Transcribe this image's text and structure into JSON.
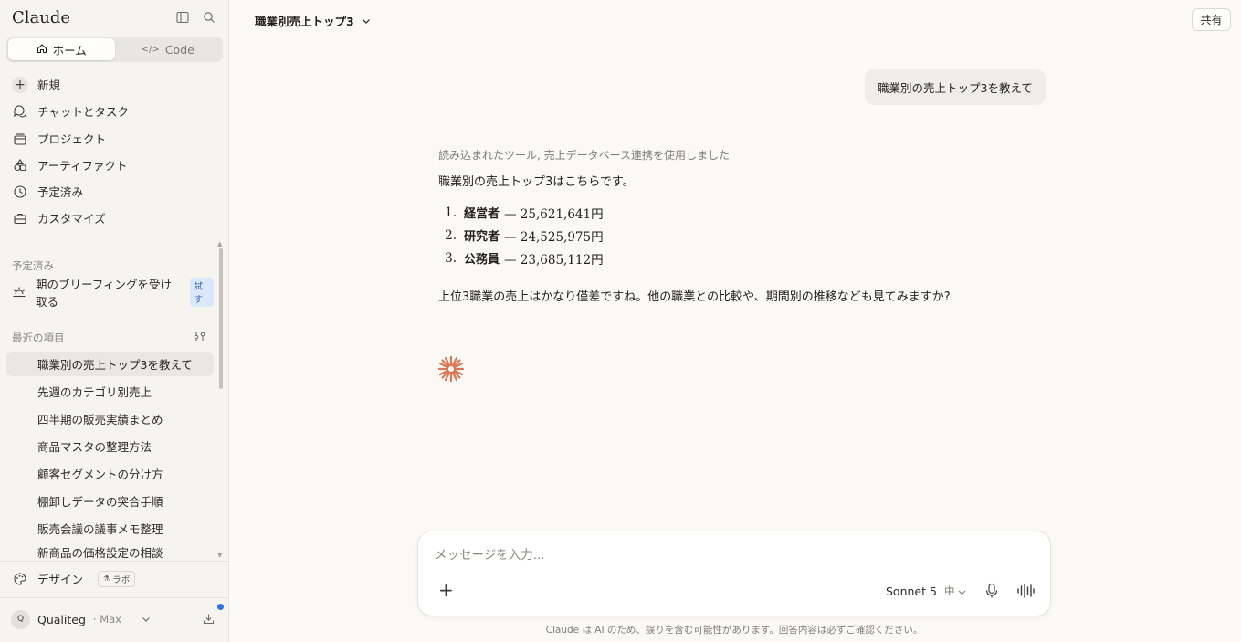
{
  "sidebar": {
    "brand": "Claude",
    "tabs": [
      {
        "label": "ホーム",
        "icon": "home-icon"
      },
      {
        "label": "Code",
        "icon": "code-icon"
      }
    ],
    "nav": [
      {
        "label": "新規",
        "icon": "plus-icon"
      },
      {
        "label": "チャットとタスク",
        "icon": "chat-icon"
      },
      {
        "label": "プロジェクト",
        "icon": "folder-icon"
      },
      {
        "label": "アーティファクト",
        "icon": "artifact-icon"
      },
      {
        "label": "予定済み",
        "icon": "clock-icon"
      },
      {
        "label": "カスタマイズ",
        "icon": "briefcase-icon"
      }
    ],
    "scheduled_label": "予定済み",
    "scheduled_item": {
      "label": "朝のブリーフィングを受け取る",
      "badge": "試す"
    },
    "recent_label": "最近の項目",
    "recents": [
      "職業別の売上トップ3を教えて",
      "先週のカテゴリ別売上",
      "四半期の販売実績まとめ",
      "商品マスタの整理方法",
      "顧客セグメントの分け方",
      "棚卸しデータの突合手順",
      "販売会議の議事メモ整理",
      "新商品の価格設定の相談"
    ],
    "design": {
      "label": "デザイン",
      "badge": "ラボ"
    },
    "user": {
      "initial": "Q",
      "name": "Qualiteg",
      "plan": "· Max"
    }
  },
  "header": {
    "title": "職業別売上トップ3",
    "share": "共有"
  },
  "conversation": {
    "user_message": "職業別の売上トップ3を教えて",
    "tool_line": "読み込まれたツール, 売上データベース連携を使用しました",
    "intro": "職業別の売上トップ3はこちらです。",
    "items": [
      {
        "num": "1.",
        "occupation": "経営者",
        "amount": "— 25,621,641円"
      },
      {
        "num": "2.",
        "occupation": "研究者",
        "amount": "— 24,525,975円"
      },
      {
        "num": "3.",
        "occupation": "公務員",
        "amount": "— 23,685,112円"
      }
    ],
    "outro": "上位3職業の売上はかなり僅差ですね。他の職業との比較や、期間別の推移なども見てみますか?"
  },
  "composer": {
    "placeholder": "メッセージを入力...",
    "model": "Sonnet 5",
    "effort": "中"
  },
  "disclaimer": "Claude は AI のため、誤りを含む可能性があります。回答内容は必ずご確認ください。",
  "colors": {
    "accent": "#d97757",
    "background": "#faf9f5",
    "sidebar": "#f5f4ef"
  }
}
